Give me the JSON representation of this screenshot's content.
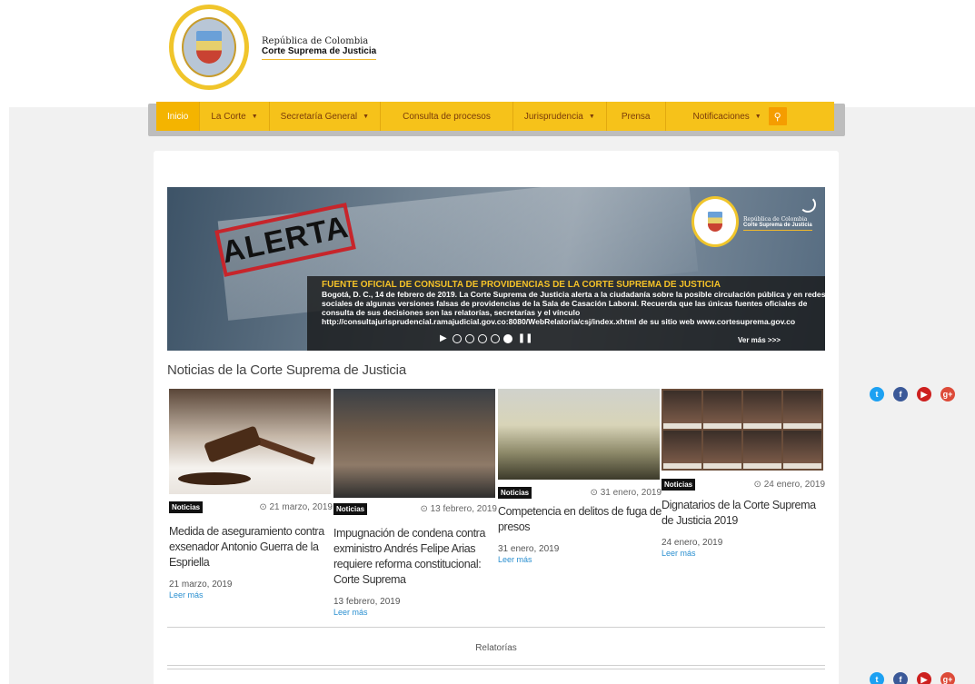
{
  "header": {
    "country": "República de Colombia",
    "institution": "Corte Suprema de Justicia"
  },
  "nav": {
    "items": [
      {
        "label": "Inicio",
        "caret": false
      },
      {
        "label": "La Corte",
        "caret": true
      },
      {
        "label": "Secretaría General",
        "caret": true
      },
      {
        "label": "Consulta de procesos",
        "caret": false
      },
      {
        "label": "Jurisprudencia",
        "caret": true
      },
      {
        "label": "Prensa",
        "caret": false
      },
      {
        "label": "Notificaciones",
        "caret": true
      }
    ],
    "search_icon": "search-icon"
  },
  "banner": {
    "stamp_text": "ALERTA",
    "brand_country": "República de Colombia",
    "brand_name": "Corte Suprema de Justicia",
    "title": "FUENTE OFICIAL DE CONSULTA DE PROVIDENCIAS DE LA CORTE SUPREMA DE JUSTICIA",
    "text": "Bogotá, D. C., 14 de febrero de 2019. La Corte Suprema de Justicia alerta a la ciudadanía sobre la posible circulación pública y en redes sociales de algunas versiones falsas de providencias de la Sala de Casación Laboral. Recuerda que las únicas fuentes oficiales de consulta de sus decisiones son las relatorías, secretarías y el vínculo http://consultajurisprudencial.ramajudicial.gov.co:8080/WebRelatoria/csj/index.xhtml de su sitio web www.cortesuprema.gov.co",
    "more": "Ver más >>>",
    "slides": 6,
    "active_slide": 5
  },
  "news_section": {
    "title": "Noticias de la Corte Suprema de Justicia",
    "items": [
      {
        "tag": "Noticias",
        "date": "21 marzo, 2019",
        "headline": "Medida de aseguramiento contra exsenador Antonio Guerra de la Espriella",
        "sub_date": "21 marzo, 2019",
        "more": "Leer más"
      },
      {
        "tag": "Noticias",
        "date": "13 febrero, 2019",
        "headline": "Impugnación de condena contra exministro Andrés Felipe Arias requiere reforma constitucional: Corte Suprema",
        "sub_date": "13 febrero, 2019",
        "more": "Leer más"
      },
      {
        "tag": "Noticias",
        "date": "31 enero, 2019",
        "headline": "Competencia en delitos de fuga de presos",
        "sub_date": "31 enero, 2019",
        "more": "Leer más"
      },
      {
        "tag": "Noticias",
        "date": "24 enero, 2019",
        "headline": "Dignatarios de la Corte Suprema de Justicia 2019",
        "sub_date": "24 enero, 2019",
        "more": "Leer más"
      }
    ]
  },
  "relatorias": "Relatorías",
  "social": {
    "icons": [
      {
        "name": "twitter-icon",
        "glyph": "t",
        "color": "#1da1f2"
      },
      {
        "name": "facebook-icon",
        "glyph": "f",
        "color": "#3b5998"
      },
      {
        "name": "youtube-icon",
        "glyph": "▶",
        "color": "#cd201f"
      },
      {
        "name": "googleplus-icon",
        "glyph": "g+",
        "color": "#dd4b39"
      }
    ]
  },
  "colors": {
    "nav_bg": "#f6c21a",
    "accent": "#f59d00",
    "link": "#2a8fd0"
  }
}
